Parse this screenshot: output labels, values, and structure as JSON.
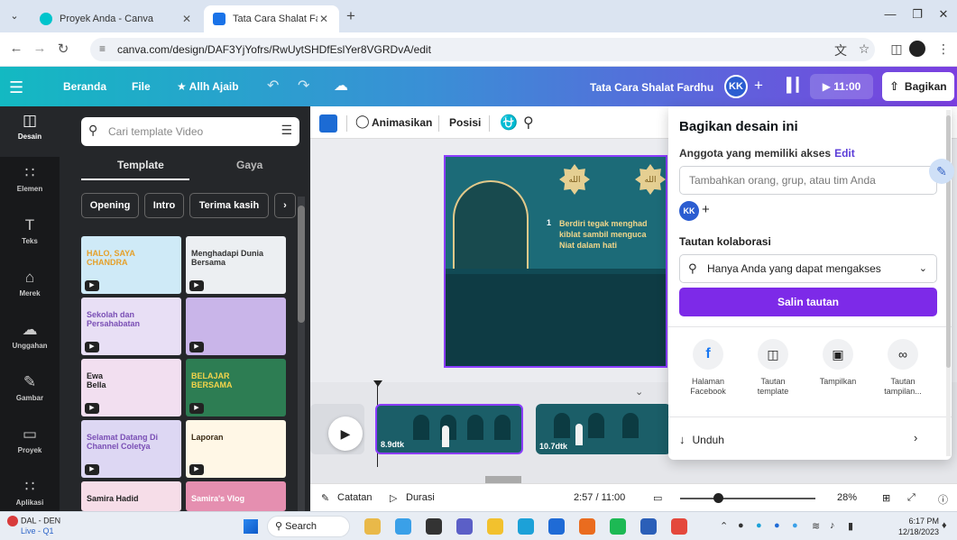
{
  "browser": {
    "tabs": [
      {
        "title": "Proyek Anda - Canva",
        "icon": "canva-favicon",
        "active": false
      },
      {
        "title": "Tata Cara Shalat Fardhu - Video",
        "icon": "video-favicon",
        "active": true
      }
    ],
    "new_tab_glyph": "+",
    "url": "canva.com/design/DAF3YjYofrs/RwUytSHDfEslYer8VGRDvA/edit"
  },
  "canva_header": {
    "home_label": "Beranda",
    "file_label": "File",
    "magic_label": "★ Allh Ajaib",
    "design_title": "Tata Cara Shalat Fardhu",
    "avatar_initials": "KK",
    "play_label": "▶ 11:00",
    "share_label": "Bagikan"
  },
  "left_rail": [
    {
      "label": "Desain",
      "icon": "layout-icon",
      "glyph": "◫",
      "active": true
    },
    {
      "label": "Elemen",
      "icon": "elements-icon",
      "glyph": "∷",
      "active": false
    },
    {
      "label": "Teks",
      "icon": "text-icon",
      "glyph": "T",
      "active": false
    },
    {
      "label": "Merek",
      "icon": "brand-icon",
      "glyph": "⌂",
      "active": false
    },
    {
      "label": "Unggahan",
      "icon": "upload-icon",
      "glyph": "☁",
      "active": false
    },
    {
      "label": "Gambar",
      "icon": "draw-icon",
      "glyph": "✎",
      "active": false
    },
    {
      "label": "Proyek",
      "icon": "folder-icon",
      "glyph": "▭",
      "active": false
    },
    {
      "label": "Aplikasi",
      "icon": "apps-icon",
      "glyph": "∷",
      "active": false
    }
  ],
  "side_panel": {
    "search_placeholder": "Cari template Video",
    "tabs": [
      "Template",
      "Gaya"
    ],
    "chips": [
      "Opening",
      "Intro",
      "Terima kasih"
    ],
    "templates": [
      {
        "text": "HALO, SAYA\nCHANDRA",
        "bg": "#cfeaf7",
        "fg": "#e5a02a"
      },
      {
        "text": "Menghadapi Dunia Bersama",
        "bg": "#eceff2",
        "fg": "#333333"
      },
      {
        "text": "Sekolah dan Persahabatan",
        "bg": "#e8dff5",
        "fg": "#7a4fb5"
      },
      {
        "text": "",
        "bg": "#c9b5e9",
        "fg": "#ffffff"
      },
      {
        "text": "Ewa\nBella",
        "bg": "#f2dff0",
        "fg": "#222222"
      },
      {
        "text": "BELAJAR\nBERSAMA",
        "bg": "#2d7d53",
        "fg": "#f4d44b"
      },
      {
        "text": "Selamat Datang Di\nChannel Coletya",
        "bg": "#ddd7f3",
        "fg": "#7a4fb5"
      },
      {
        "text": "Laporan",
        "bg": "#fff7e6",
        "fg": "#3a2a14"
      },
      {
        "text": "Samira Hadid",
        "bg": "#f6dde8",
        "fg": "#222222"
      },
      {
        "text": "Samira's Vlog",
        "bg": "#e58fb0",
        "fg": "#ffffff"
      }
    ]
  },
  "toolbar": {
    "animate_label": "Animasikan",
    "position_label": "Posisi"
  },
  "slide": {
    "star_glyph": "الله",
    "number": "1",
    "text": "Berdiri tegak menghad\nkiblat sambil menguca\nNiat dalam hati"
  },
  "timeline": {
    "clips": [
      {
        "label": "",
        "selected": false
      },
      {
        "label": "8.9dtk",
        "selected": true
      },
      {
        "label": "10.7dtk",
        "selected": false
      }
    ]
  },
  "footer": {
    "notes_label": "Catatan",
    "duration_label": "Durasi",
    "time": "2:57 / 11:00",
    "zoom": "28%",
    "zoom_fraction": 0.28
  },
  "share_panel": {
    "title": "Bagikan desain ini",
    "members_label": "Anggota yang memiliki akses",
    "edit_label": "Edit",
    "add_placeholder": "Tambahkan orang, grup, atau tim Anda",
    "avatar_initials": "KK",
    "collab_label": "Tautan kolaborasi",
    "access_value": "Hanya Anda yang dapat mengakses",
    "copy_label": "Salin tautan",
    "options": [
      {
        "label": "Halaman\nFacebook",
        "icon": "facebook-icon",
        "glyph": "f"
      },
      {
        "label": "Tautan\ntemplate",
        "icon": "template-icon",
        "glyph": "◫"
      },
      {
        "label": "Tampilkan",
        "icon": "present-icon",
        "glyph": "▣"
      },
      {
        "label": "Tautan\ntampilan...",
        "icon": "link-icon",
        "glyph": "∞"
      }
    ],
    "download_label": "Unduh"
  },
  "taskbar": {
    "live_line1": "DAL - DEN",
    "live_line2": "Live - Q1",
    "search_label": "Search",
    "time": "6:17 PM",
    "date": "12/18/2023",
    "apps": [
      {
        "name": "photos-app",
        "color": "#e9b949"
      },
      {
        "name": "copilot-app",
        "color": "#3aa0e8"
      },
      {
        "name": "taskview-app",
        "color": "#333333"
      },
      {
        "name": "chat-app",
        "color": "#5b5fc7"
      },
      {
        "name": "files-app",
        "color": "#f2c12e"
      },
      {
        "name": "edge-app",
        "color": "#1ca1d8"
      },
      {
        "name": "store-app",
        "color": "#1f6bd6"
      },
      {
        "name": "firefox-app",
        "color": "#ea6c1f"
      },
      {
        "name": "spotify-app",
        "color": "#1db954"
      },
      {
        "name": "word-app",
        "color": "#2b5fb8"
      },
      {
        "name": "chrome-app",
        "color": "#e4483c"
      }
    ]
  }
}
